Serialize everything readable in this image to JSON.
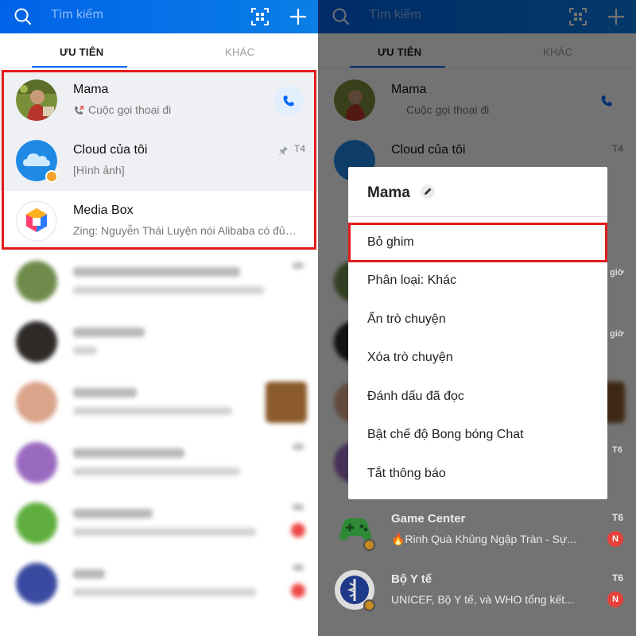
{
  "header": {
    "search_placeholder": "Tìm kiếm"
  },
  "tabs": {
    "priority_label": "ƯU TIÊN",
    "other_label": "KHÁC"
  },
  "conversations": [
    {
      "name": "Mama",
      "preview": "Cuộc gọi thoại đi",
      "time": ""
    },
    {
      "name": "Cloud của tôi",
      "preview": "[Hình ảnh]",
      "time": "T4"
    },
    {
      "name": "Media Box",
      "preview": "Zing: Nguyễn Thái Luyện nói Alibaba có đủ…",
      "time": ""
    }
  ],
  "context_menu": {
    "title": "Mama",
    "items": [
      "Bỏ ghim",
      "Phân loại: Khác",
      "Ẩn trò chuyện",
      "Xóa trò chuyện",
      "Đánh dấu đã đọc",
      "Bật chế độ Bong bóng Chat",
      "Tắt thông báo"
    ]
  },
  "background_rows": [
    {
      "name": "Game Center",
      "preview": "🔥Rinh Quà Khủng Ngập Tràn - Sự...",
      "time": "T6",
      "badge": "N"
    },
    {
      "name": "Bộ Y tế",
      "preview": "UNICEF, Bộ Y tế, và WHO tổng kết...",
      "time": "T6",
      "badge": "N"
    }
  ],
  "peek_labels": {
    "time_gio_1": "giờ",
    "time_gio_2": "giờ",
    "time_t6": "T6"
  },
  "colors": {
    "brand_blue": "#0068ff",
    "highlight_red": "#e21b1b",
    "badge_red": "#e8403a"
  }
}
